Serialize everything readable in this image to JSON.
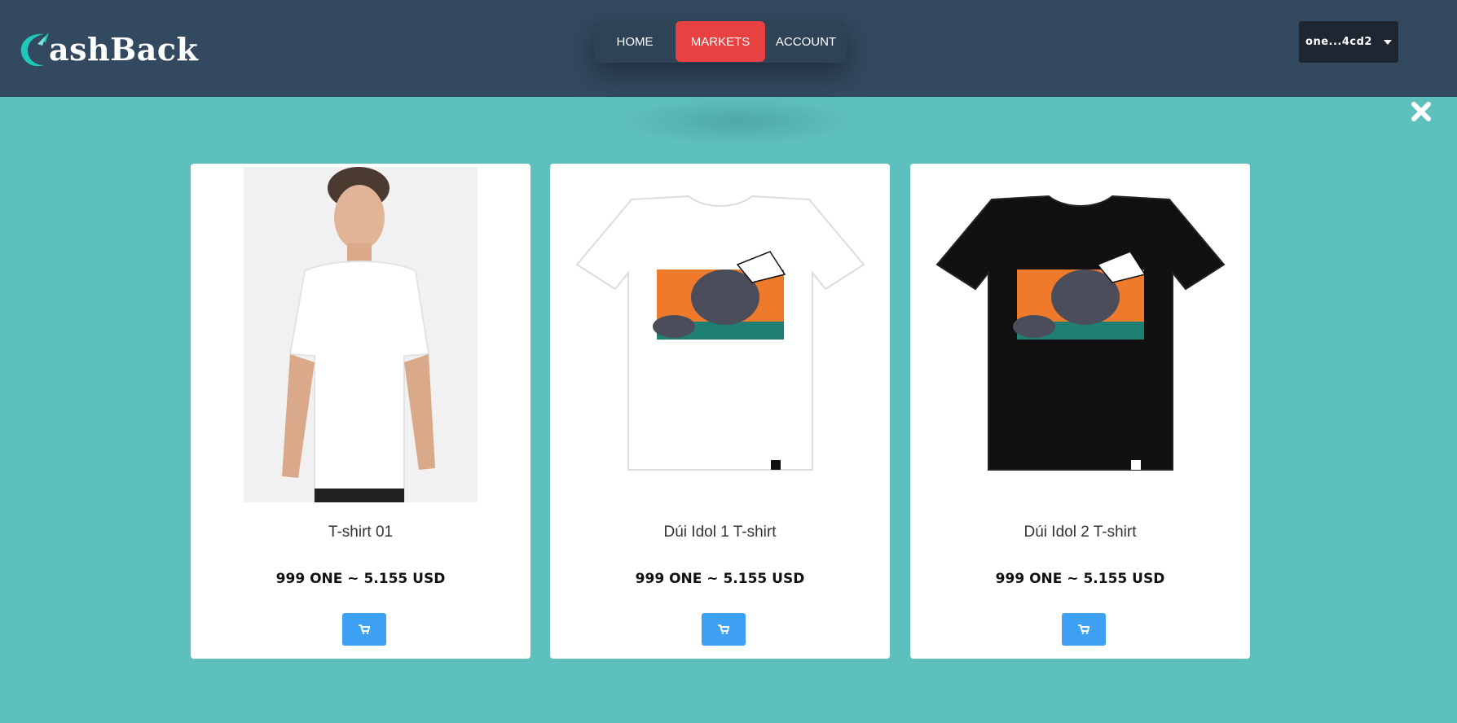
{
  "brand": {
    "name": "ashBack",
    "accent": "#1fc8b8"
  },
  "nav": {
    "items": [
      "HOME",
      "MARKETS",
      "ACCOUNT"
    ],
    "active": "MARKETS",
    "active_color": "#e84142"
  },
  "wallet": {
    "address": "one...4cd2"
  },
  "colors": {
    "background": "#5ec0bc",
    "header": "#33495f",
    "cart_button": "#3da0f2"
  },
  "products": [
    {
      "title": "T-shirt 01",
      "price": "999 ONE ~ 5.155 USD",
      "image": "man-in-white-tshirt"
    },
    {
      "title": "Dúi Idol 1 T-shirt",
      "price": "999 ONE ~ 5.155 USD",
      "image": "white-tshirt-comic-print"
    },
    {
      "title": "Dúi Idol 2 T-shirt",
      "price": "999 ONE ~ 5.155 USD",
      "image": "black-tshirt-comic-print"
    }
  ],
  "icons": {
    "close": "close-icon",
    "cart": "cart-icon",
    "dropdown": "caret-down-icon"
  }
}
